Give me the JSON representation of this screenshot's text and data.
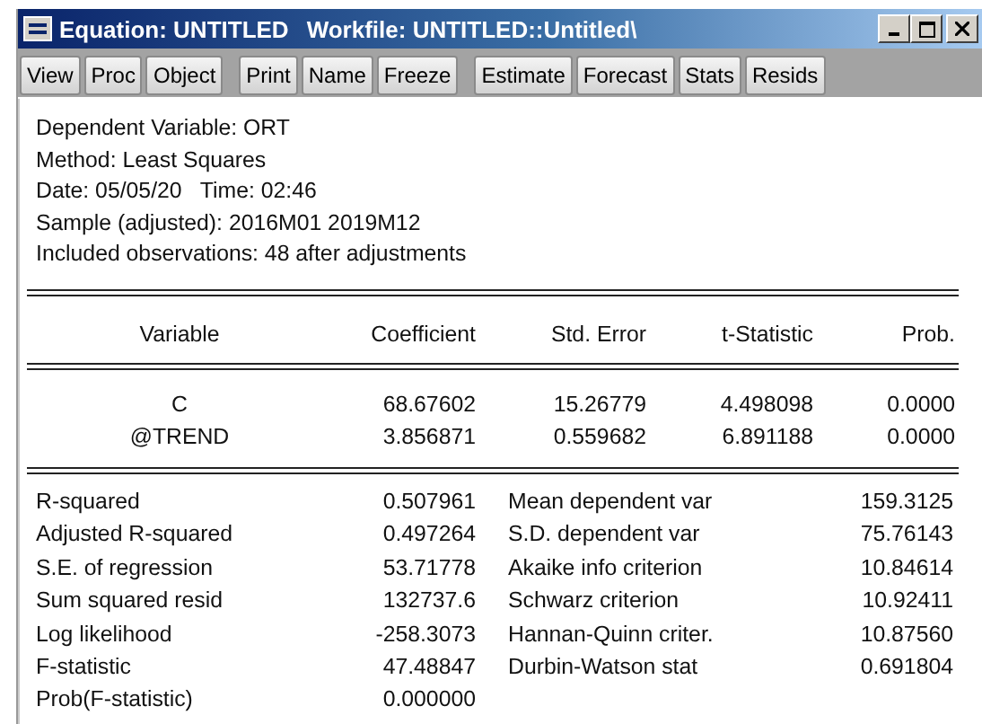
{
  "window": {
    "title": "Equation: UNTITLED",
    "workfile": "Workfile: UNTITLED::Untitled\\"
  },
  "toolbar": {
    "groups": [
      [
        "View",
        "Proc",
        "Object"
      ],
      [
        "Print",
        "Name",
        "Freeze"
      ],
      [
        "Estimate",
        "Forecast",
        "Stats",
        "Resids"
      ]
    ]
  },
  "header": [
    "Dependent Variable: ORT",
    "Method: Least Squares",
    "Date: 05/05/20   Time: 02:46",
    "Sample (adjusted): 2016M01 2019M12",
    "Included observations: 48 after adjustments"
  ],
  "table": {
    "columns": [
      "Variable",
      "Coefficient",
      "Std. Error",
      "t-Statistic",
      "Prob."
    ],
    "rows": [
      [
        "C",
        "68.67602",
        "15.26779",
        "4.498098",
        "0.0000"
      ],
      [
        "@TREND",
        "3.856871",
        "0.559682",
        "6.891188",
        "0.0000"
      ]
    ]
  },
  "statistics": [
    {
      "label": "R-squared",
      "value": "0.507961",
      "label_2": "Mean dependent var",
      "value_2": "159.3125"
    },
    {
      "label": "Adjusted R-squared",
      "value": "0.497264",
      "label_2": "S.D. dependent var",
      "value_2": "75.76143"
    },
    {
      "label": "S.E. of regression",
      "value": "53.71778",
      "label_2": "Akaike info criterion",
      "value_2": "10.84614"
    },
    {
      "label": "Sum squared resid",
      "value": "132737.6",
      "label_2": "Schwarz criterion",
      "value_2": "10.92411"
    },
    {
      "label": "Log likelihood",
      "value": "-258.3073",
      "label_2": "Hannan-Quinn criter.",
      "value_2": "10.87560"
    },
    {
      "label": "F-statistic",
      "value": "47.48847",
      "label_2": "Durbin-Watson stat",
      "value_2": "0.691804"
    },
    {
      "label": "Prob(F-statistic)",
      "value": "0.000000"
    }
  ]
}
